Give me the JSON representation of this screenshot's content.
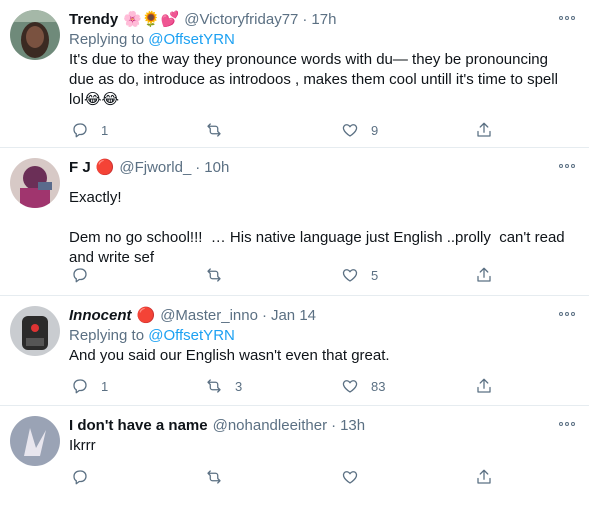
{
  "tweets": [
    {
      "name": "Trendy",
      "emoji": "🌸🌻💕",
      "handle": "@Victoryfriday77",
      "time": "17h",
      "replying_prefix": "Replying to ",
      "replying_to": "@OffsetYRN",
      "text": "It's due to the way they pronounce words with du— they be pronouncing due as do, introduce as introdoos , makes them cool untill it's time to spell lol😂😂",
      "replies": "1",
      "retweets": "",
      "likes": "9"
    },
    {
      "name": "F J",
      "emoji": "🔴",
      "handle": "@Fjworld_",
      "time": "10h",
      "replying_prefix": "",
      "replying_to": "",
      "text": "Exactly!\n\nDem no go school!!!  … His native language just English ..prolly  can't read and write sef",
      "replies": "",
      "retweets": "",
      "likes": "5"
    },
    {
      "name": "Innocent",
      "emoji": "🔴",
      "handle": "@Master_inno",
      "time": "Jan 14",
      "replying_prefix": "Replying to ",
      "replying_to": "@OffsetYRN",
      "text": "And you said our English wasn't even that great.",
      "replies": "1",
      "retweets": "3",
      "likes": "83"
    },
    {
      "name": "I don't have a name",
      "emoji": "",
      "handle": "@nohandleeither",
      "time": "13h",
      "replying_prefix": "",
      "replying_to": "",
      "text": "Ikrrr",
      "replies": "",
      "retweets": "",
      "likes": ""
    }
  ],
  "separator": "·",
  "icons": [
    "reply-icon",
    "retweet-icon",
    "like-icon",
    "share-icon",
    "more-icon"
  ],
  "colors": {
    "link": "#1da1f2",
    "secondary": "#5b7083",
    "divider": "#e6ecf0"
  }
}
